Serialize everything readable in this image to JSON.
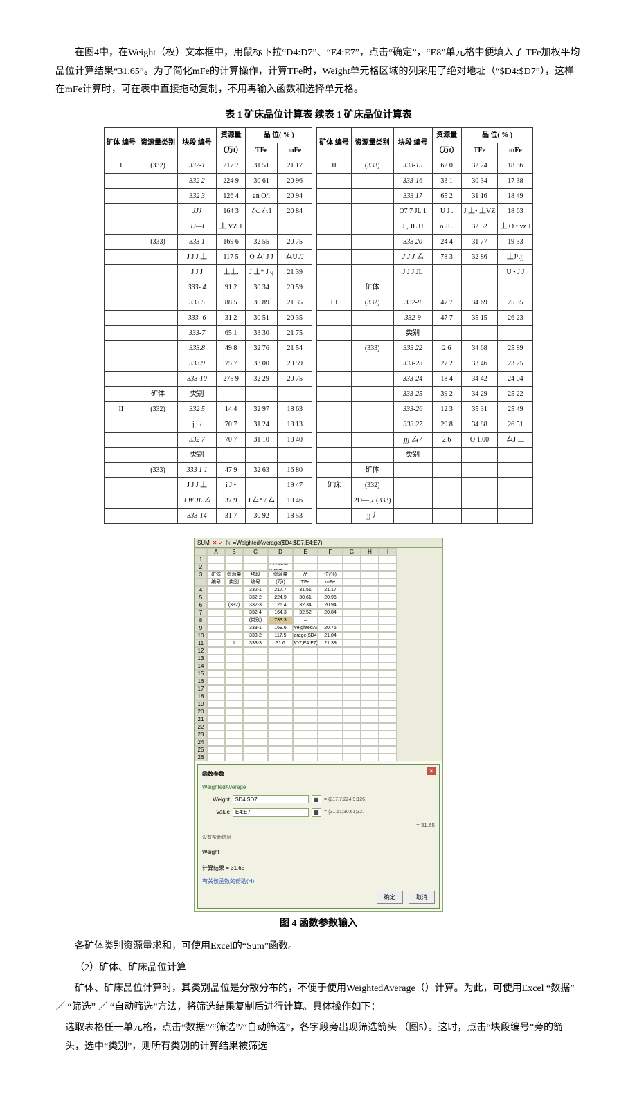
{
  "p1": "在图4中，在Weight（权）文本框中，用鼠标下拉“D4:D7”、“E4:E7”，点击“确定”，“E8”单元格中便填入了 TFe加权平均品位计算结果“31.65”。为了简化mFe的计算操作，计算TFe时，Weight单元格区域的列采用了绝对地址（“$D4:$D7”），这样在mFe计算时，可在表中直接拖动复制，不用再输入函数和选择单元格。",
  "table_title": "表  1 矿床品位计算表  续表  1 矿床品位计算表",
  "hd_no": "矿体 编号",
  "hd_cat": "资源量类别",
  "hd_blk": "块段 编号",
  "hd_res_top": "资源量",
  "hd_res_unit": "（万t）",
  "hd_grade": "品 位( % )",
  "hd_tfe": "TFe",
  "hd_mfe": "mFe",
  "body_label": "矿体",
  "cat_label": "类别",
  "kc_label": "矿床",
  "left_rows": [
    {
      "no": "I",
      "cat": "(332)",
      "blk": "332-1",
      "res": "217 7",
      "tfe": "31 51",
      "mfe": "21 17"
    },
    {
      "no": "",
      "cat": "",
      "blk": "332 2",
      "res": "224 9",
      "tfe": "30 61",
      "mfe": "20 96"
    },
    {
      "no": "",
      "cat": "",
      "blk": "332 3",
      "res": "126 4",
      "tfe": "an O/i",
      "mfe": "20 94"
    },
    {
      "no": "",
      "cat": "",
      "blk": "JJJ",
      "res": "164 3",
      "tfe": "厶. 厶1",
      "mfe": "20 84"
    },
    {
      "no": "",
      "cat": "",
      "blk": "JJ—I",
      "res": "丄  VZ 1",
      "tfe": "",
      "mfe": ""
    },
    {
      "no": "",
      "cat": "(333)",
      "blk": "333 1",
      "res": "169 6",
      "tfe": "32 55",
      "mfe": "20 75"
    },
    {
      "no": "",
      "cat": "",
      "blk": "J J J 丄",
      "res": "117 5",
      "tfe": "O 厶' J J",
      "mfe": "厶U./J"
    },
    {
      "no": "",
      "cat": "",
      "blk": "J J J",
      "res": "丄丄.",
      "tfe": "J 丄* J q",
      "mfe": "21 39"
    },
    {
      "no": "",
      "cat": "",
      "blk": "333- 4",
      "res": "91 2",
      "tfe": "30 34",
      "mfe": "20 59"
    },
    {
      "no": "",
      "cat": "",
      "blk": "333 5",
      "res": "88 5",
      "tfe": "30 89",
      "mfe": "21 35"
    },
    {
      "no": "",
      "cat": "",
      "blk": "333-  6",
      "res": "31 2",
      "tfe": "30 51",
      "mfe": "20 35"
    },
    {
      "no": "",
      "cat": "",
      "blk": "333-7",
      "res": "65 1",
      "tfe": "33 30",
      "mfe": "21 75"
    },
    {
      "no": "",
      "cat": "",
      "blk": "333.8",
      "res": "49 8",
      "tfe": "32 76",
      "mfe": "21 54"
    },
    {
      "no": "",
      "cat": "",
      "blk": "333.9",
      "res": "75 7",
      "tfe": "33 00",
      "mfe": "20 59"
    },
    {
      "no": "",
      "cat": "",
      "blk": "333-10",
      "res": "275 9",
      "tfe": "32 29",
      "mfe": "20 75"
    },
    {
      "no": "",
      "cat": "矿体",
      "blk": "类别",
      "res": "",
      "tfe": "",
      "mfe": ""
    },
    {
      "no": "II",
      "cat": "(332)",
      "blk": "332 5",
      "res": "14 4",
      "tfe": "32 97",
      "mfe": "18 63"
    },
    {
      "no": "",
      "cat": "",
      "blk": "j j /",
      "res": "70 7",
      "tfe": "31 24",
      "mfe": "18 13"
    },
    {
      "no": "",
      "cat": "",
      "blk": "332 7",
      "res": "70 7",
      "tfe": "31 10",
      "mfe": "18 40"
    },
    {
      "no": "",
      "cat": "",
      "blk": "类别",
      "res": "",
      "tfe": "",
      "mfe": ""
    },
    {
      "no": "",
      "cat": "(333)",
      "blk": "333 1 1",
      "res": "47 9",
      "tfe": "32 63",
      "mfe": "16 80"
    },
    {
      "no": "",
      "cat": "",
      "blk": "J J J 丄",
      "res": "i J •",
      "tfe": "",
      "mfe": "19 47"
    },
    {
      "no": "",
      "cat": "",
      "blk": "J W  JL 厶",
      "res": "37 9",
      "tfe": "J 厶* / 厶",
      "mfe": "18 46"
    },
    {
      "no": "",
      "cat": "",
      "blk": "333-14",
      "res": "31 7",
      "tfe": "30 92",
      "mfe": "18 53"
    }
  ],
  "right_rows": [
    {
      "no": "II",
      "cat": "(333)",
      "blk": "333-15",
      "res": "62 0",
      "tfe": "32 24",
      "mfe": "18 36"
    },
    {
      "no": "",
      "cat": "",
      "blk": "333-16",
      "res": "33 1",
      "tfe": "30 34",
      "mfe": "17 38"
    },
    {
      "no": "",
      "cat": "",
      "blk": "333 17",
      "res": "65 2",
      "tfe": "31 16",
      "mfe": "18 49"
    },
    {
      "no": "",
      "cat": "",
      "blk": "O7 7 JL 1",
      "res": "U J .",
      "tfe": "J 丄• 丄VZ",
      "mfe": "18 63"
    },
    {
      "no": "",
      "cat": "",
      "blk": "J , JL U",
      "res": "o J¹ .",
      "tfe": "32 52",
      "mfe": "丄 O • vz J"
    },
    {
      "no": "",
      "cat": "",
      "blk": "333 20",
      "res": "24 4",
      "tfe": "31 77",
      "mfe": "19 33"
    },
    {
      "no": "",
      "cat": "",
      "blk": "J J J 厶",
      "res": "78 3",
      "tfe": "32 86",
      "mfe": "丄J¹.jj"
    },
    {
      "no": "",
      "cat": "",
      "blk": "J J J  JL",
      "res": "",
      "tfe": "",
      "mfe": "U • J J"
    },
    {
      "no": "",
      "cat": "矿体",
      "blk": "",
      "res": "",
      "tfe": "",
      "mfe": ""
    },
    {
      "no": "III",
      "cat": "(332)",
      "blk": "332-8",
      "res": "47 7",
      "tfe": "34 69",
      "mfe": "25 35"
    },
    {
      "no": "",
      "cat": "",
      "blk": "332-9",
      "res": "47 7",
      "tfe": "35 15",
      "mfe": "26 23"
    },
    {
      "no": "",
      "cat": "",
      "blk": "类别",
      "res": "",
      "tfe": "",
      "mfe": ""
    },
    {
      "no": "",
      "cat": "(333)",
      "blk": "333 22",
      "res": "2 6",
      "tfe": "34 68",
      "mfe": "25 89"
    },
    {
      "no": "",
      "cat": "",
      "blk": "333-23",
      "res": "27 2",
      "tfe": "33 46",
      "mfe": "23 25"
    },
    {
      "no": "",
      "cat": "",
      "blk": "333-24",
      "res": "18 4",
      "tfe": "34 42",
      "mfe": "24 04"
    },
    {
      "no": "",
      "cat": "",
      "blk": "333-25",
      "res": "39 2",
      "tfe": "34 29",
      "mfe": "25 22"
    },
    {
      "no": "",
      "cat": "",
      "blk": "333-26",
      "res": "12 3",
      "tfe": "35 31",
      "mfe": "25 49"
    },
    {
      "no": "",
      "cat": "",
      "blk": "333 27",
      "res": "29 8",
      "tfe": "34 88",
      "mfe": "26 51"
    },
    {
      "no": "",
      "cat": "",
      "blk": "jjj  厶 /",
      "res": "2 6",
      "tfe": "O 1.00",
      "mfe": "厶J 丄"
    },
    {
      "no": "",
      "cat": "",
      "blk": "类别",
      "res": "",
      "tfe": "",
      "mfe": ""
    },
    {
      "no": "",
      "cat": "矿体",
      "blk": "",
      "res": "",
      "tfe": "",
      "mfe": ""
    },
    {
      "no": "矿床",
      "cat": "(332)",
      "blk": "",
      "res": "",
      "tfe": "",
      "mfe": ""
    },
    {
      "no": "",
      "cat": "2D—丿(333)",
      "blk": "",
      "res": "",
      "tfe": "",
      "mfe": ""
    },
    {
      "no": "",
      "cat": "jj丿",
      "blk": "",
      "res": "",
      "tfe": "",
      "mfe": ""
    }
  ],
  "fig": {
    "formula_name": "SUM",
    "fx": "fx",
    "formula": "=WeightedAverage($D4:$D7,E4:E7)",
    "cols": [
      "",
      "A",
      "B",
      "C",
      "D",
      "E",
      "F",
      "G",
      "H",
      "I"
    ],
    "title_cell": "矿床品位计算表",
    "h_row": [
      "3",
      "矿体",
      "资源量",
      "块段",
      "资源量",
      "品",
      "位(%)",
      "",
      "",
      ""
    ],
    "h_row2": [
      "",
      "编号",
      "类别",
      "编号",
      "(万t)",
      "TFe",
      "mFe",
      "",
      "",
      ""
    ],
    "rows": [
      [
        "4",
        "",
        "",
        "332-1",
        "217.7",
        "31.51",
        "21.17",
        "",
        "",
        ""
      ],
      [
        "5",
        "",
        "",
        "332-2",
        "224.9",
        "30.61",
        "20.96",
        "",
        "",
        ""
      ],
      [
        "6",
        "",
        "(332)",
        "332-3",
        "126.4",
        "32.34",
        "20.94",
        "",
        "",
        ""
      ],
      [
        "7",
        "",
        "",
        "332-4",
        "164.3",
        "32.52",
        "20.84",
        "",
        "",
        ""
      ],
      [
        "8",
        "",
        "",
        "(类别)",
        "733.3",
        "=",
        "",
        "",
        "",
        ""
      ],
      [
        "9",
        "",
        "",
        "333-1",
        "169.6",
        "WeightedAv",
        "20.75",
        "",
        "",
        ""
      ],
      [
        "10",
        "",
        "",
        "333-2",
        "117.5",
        "erage($D4",
        "21.04",
        "",
        "",
        ""
      ],
      [
        "11",
        "",
        "I",
        "333-3",
        "31.6",
        "$D7,E4:E7)",
        "21.39",
        "",
        "",
        ""
      ]
    ],
    "row_nums_tail": [
      "12",
      "13",
      "14",
      "15",
      "16",
      "17",
      "18",
      "19",
      "20",
      "21",
      "22",
      "23",
      "24",
      "25",
      "26"
    ],
    "dlg_title": "函数参数",
    "dlg_fn": "WeightedAverage",
    "dlg_weight_lbl": "Weight",
    "dlg_weight_val": "$D4:$D7",
    "dlg_weight_res": "= {217.7;224.9;126.",
    "dlg_value_lbl": "Value",
    "dlg_value_val": "E4:E7",
    "dlg_value_res": "= {31.51;30.61;32.",
    "dlg_eq": "= 31.65",
    "dlg_help": "没有帮助信息",
    "dlg_weight2": "Weight",
    "dlg_result_lbl": "计算结果 =",
    "dlg_result_val": "31.65",
    "dlg_link": "有关该函数的帮助(H)",
    "btn_ok": "确定",
    "btn_cancel": "取消",
    "caption": "图  4 函数参数输入"
  },
  "p2": "各矿体类别资源量求和，可使用Excel的“Sum”函数。",
  "p3": "（2）矿体、矿床品位计算",
  "p4": "矿体、矿床品位计算时，其类别品位是分散分布的，不便于使用WeightedAverage（）计算。为此，可使用Excel “数据” ／ “筛选” ／ “自动筛选”方法，将筛选结果复制后进行计算。具体操作如下：",
  "p5": "选取表格任一单元格，点击“数据”/“筛选”/“自动筛选”，各字段旁出现筛选箭头 （图5）。这时，点击“块段编号”旁的箭头，选中“类别”，则所有类别的计算结果被筛选"
}
